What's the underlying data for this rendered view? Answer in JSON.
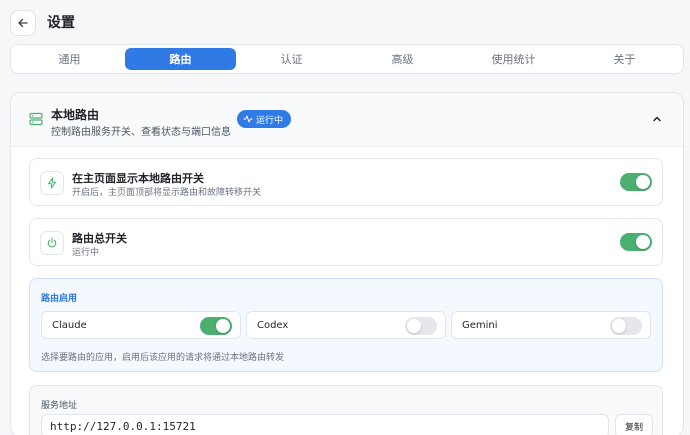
{
  "header": {
    "title": "设置",
    "back_icon": "arrow-left-icon"
  },
  "tabs": [
    {
      "label": "通用",
      "active": false
    },
    {
      "label": "路由",
      "active": true
    },
    {
      "label": "认证",
      "active": false
    },
    {
      "label": "高级",
      "active": false
    },
    {
      "label": "使用统计",
      "active": false
    },
    {
      "label": "关于",
      "active": false
    }
  ],
  "panel": {
    "title": "本地路由",
    "subtitle": "控制路由服务开关、查看状态与端口信息",
    "status_badge": "运行中",
    "icon": "server-icon",
    "collapse_icon": "chevron-up-icon"
  },
  "show_switch": {
    "title": "在主页面显示本地路由开关",
    "subtitle": "开启后，主页面顶部将显示路由和故障转移开关",
    "icon": "lightning-icon",
    "enabled": true
  },
  "master_switch": {
    "title": "路由总开关",
    "subtitle": "运行中",
    "icon": "power-icon",
    "enabled": true
  },
  "routing": {
    "label": "路由启用",
    "apps": [
      {
        "name": "Claude",
        "enabled": true
      },
      {
        "name": "Codex",
        "enabled": false
      },
      {
        "name": "Gemini",
        "enabled": false
      }
    ],
    "hint": "选择要路由的应用，启用后该应用的请求将通过本地路由转发"
  },
  "service": {
    "label": "服务地址",
    "value": "http://127.0.0.1:15721",
    "copy_label": "复制"
  },
  "colors": {
    "accent": "#2f7ae5",
    "toggle_on": "#4caf72",
    "toggle_off": "#e5e7eb"
  }
}
